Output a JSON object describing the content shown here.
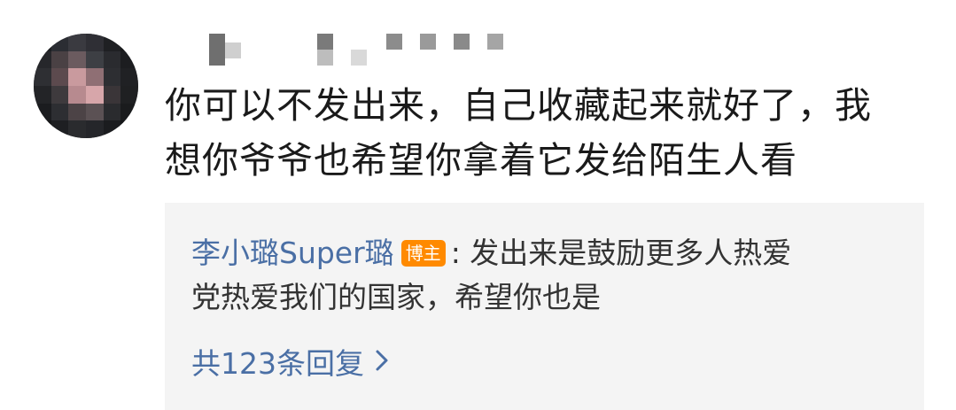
{
  "comment": {
    "text_line1": "你可以不发出来，自己收藏起来就好了，我",
    "text_line2": "想你爷爷也希望你拿着它发给陌生人看"
  },
  "reply": {
    "author": "李小璐Super璐",
    "badge": "博主",
    "separator": ":",
    "text_line1": " 发出来是鼓励更多人热爱",
    "text_line2": "党热爱我们的国家，希望你也是",
    "more_label": "共123条回复",
    "more_icon": "chevron-right-icon"
  },
  "colors": {
    "link": "#4a6fa5",
    "badge": "#ff8a00",
    "reply_bg": "#f4f4f4"
  }
}
